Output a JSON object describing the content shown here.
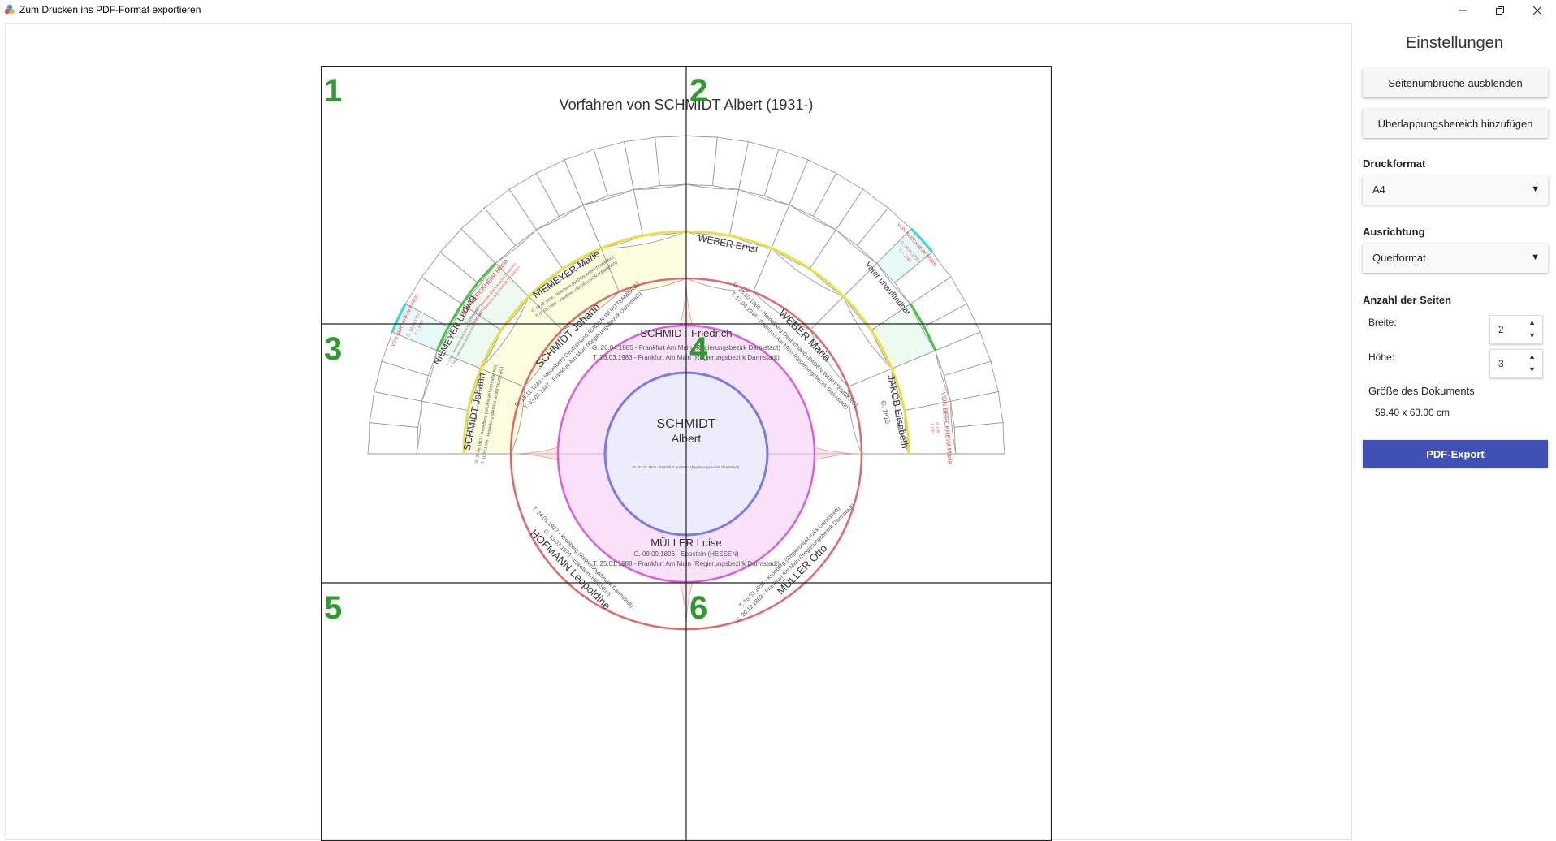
{
  "window": {
    "title": "Zum Drucken ins PDF-Format exportieren",
    "minimize_icon": "minimize-icon",
    "restore_icon": "restore-icon",
    "close_icon": "close-icon"
  },
  "preview": {
    "chart_title": "Vorfahren von SCHMIDT Albert (1931-)",
    "page_numbers": [
      "1",
      "2",
      "3",
      "4",
      "5",
      "6"
    ],
    "root": {
      "surname": "SCHMIDT",
      "given": "Albert",
      "birth": "G. 03.02.1931 - Frankfurt Am Main (Regierungsbezirk Darmstadt)"
    },
    "father": {
      "name": "SCHMIDT Friedrich",
      "birth": "G. 26.04.1885 - Frankfurt Am Main (Regierungsbezirk Darmstadt)",
      "death": "T. 26.03.1983 - Frankfurt Am Main (Regierungsbezirk Darmstadt)"
    },
    "mother": {
      "name": "MÜLLER Luise",
      "birth": "G. 08.09.1896 - Eppstein (HESSEN)",
      "death": "T. 25.01.1988 - Frankfurt Am Main (Regierungsbezirk Darmstadt)"
    },
    "grandparents": {
      "ff": {
        "name": "SCHMIDT Johann",
        "birth": "G. 15.11.1849 - Heidelberg Deutschland (BADEN-WÜRTTEMBERG)",
        "death": "T. 03.03.1947 - Frankfurt Am Main (Regierungsbezirk Darmstadt)"
      },
      "fm": {
        "name": "WEBER Maria",
        "birth": "G. 28.10.1860 - Heidelberg Deutschland (BADEN-WÜRTTEMBERG)",
        "death": "T. 17.04.1948 - Frankfurt Am Main (Regierungsbezirk Darmstadt)"
      },
      "mf": {
        "name": "MÜLLER Otto",
        "birth": "G. 20.12.1863 - Frankfurt Am Main (Regierungsbezirk Darmstadt)",
        "death": "T. 15.03.1955 - Kronberg (Regierungsbezirk Darmstadt)"
      },
      "mm": {
        "name": "HOFMANN Leopoldine",
        "birth": "G. 13.03.1870 - Eppstein (HESSEN)",
        "death": "T. 24.01.1927 - Kronberg (Regierungsbezirk Darmstadt)"
      }
    },
    "gen3": {
      "fff": {
        "name": "SCHMIDT Johann",
        "birth": "G. 25.06.1811 - Heidelberg (BADEN-WÜRTTEMBERG)",
        "death": "T. 11.02.1878 - Heidelberg (BADEN-WÜRTTEMBERG)"
      },
      "ffm": {
        "name": "NIEMEYER Marie",
        "birth": "G. 08.02.1816 - Weinheim (BADEN-WÜRTTEMBERG)",
        "death": "T. 07.09.1890 - Weinheim (BADEN-WÜRTTEMBERG)"
      },
      "fmf": {
        "name": "WEBER Ernst",
        "birth": "",
        "death": ""
      },
      "fmm": {
        "name": "JAKOB Elisabeth",
        "birth": "G. 1810 -",
        "death": ""
      }
    },
    "gen4": {
      "ffmf": {
        "name": "NIEMEYER Ludwig",
        "birth": "G. 1785 - Weinheim (BADEN-WÜRTTEMBERG)",
        "death": "T. 1852 - Weinheim (BADEN-WÜRTTEMBERG)"
      },
      "ffmm": {
        "name": "VON BERCKHEIM Maria",
        "birth": "G. 16.11.1790 - Weinheim (BADEN-WÜRTTEMBERG)",
        "death": "T. 03.04.1861 - Weinheim (BADEN-WÜRTTEMBERG)"
      },
      "fmmf": {
        "name": "Vater unauffindbar",
        "birth": "",
        "death": ""
      },
      "fmmm": {
        "name": "VON BERCKHEIM Maria",
        "birth": "G. 1790 -",
        "death": "T. 1851 -"
      }
    },
    "gen5": {
      "ffmmf": {
        "name": "VON BERCKHEIM Philipp",
        "birth": "G. 30.03.1737",
        "death": "T. ~ 1787"
      },
      "fmmmf": {
        "name": "VON BERCKHEIM Philipp",
        "birth": "G. 30.03.1737",
        "death": "T. ~ 1787"
      }
    }
  },
  "settings": {
    "title": "Einstellungen",
    "hide_page_breaks": "Seitenumbrüche ausblenden",
    "add_overlap": "Überlappungsbereich hinzufügen",
    "print_format_label": "Druckformat",
    "print_format_value": "A4",
    "orientation_label": "Ausrichtung",
    "orientation_value": "Querformat",
    "page_count_label": "Anzahl der Seiten",
    "width_label": "Breite:",
    "width_value": "2",
    "height_label": "Höhe:",
    "height_value": "3",
    "doc_size_label": "Größe des Dokuments",
    "doc_size_value": "59.40 x 63.00 cm",
    "export_button": "PDF-Export",
    "arrow_icon": "dropdown-arrow-icon"
  }
}
